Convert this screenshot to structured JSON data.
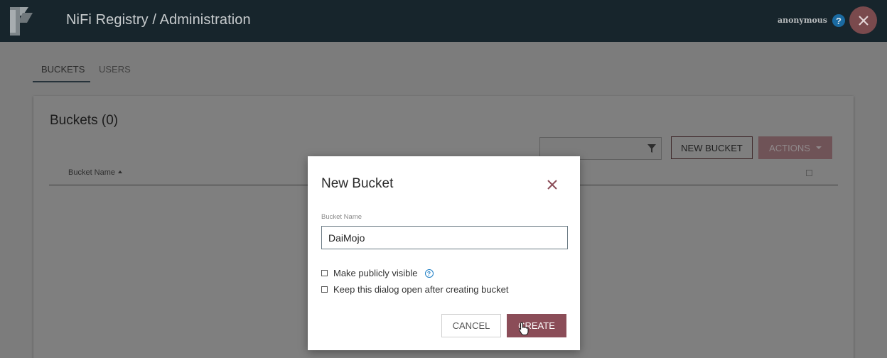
{
  "header": {
    "title": "NiFi Registry / Administration",
    "user": "anonymous",
    "help_glyph": "?",
    "logo_icon": "nifi-registry-logo-icon",
    "close_icon": "close-icon"
  },
  "tabs": [
    {
      "label": "BUCKETS",
      "active": true
    },
    {
      "label": "USERS",
      "active": false
    }
  ],
  "buckets_panel": {
    "title": "Buckets (0)",
    "filter_value": "",
    "filter_icon": "filter-icon",
    "new_bucket_label": "NEW BUCKET",
    "actions_label": "ACTIONS",
    "column_header": "Bucket Name"
  },
  "dialog": {
    "title": "New Bucket",
    "field_label": "Bucket Name",
    "bucket_name_value": "DaiMojo",
    "make_public_label": "Make publicly visible",
    "make_public_checked": false,
    "keep_open_label": "Keep this dialog open after creating bucket",
    "keep_open_checked": false,
    "info_glyph": "?",
    "cancel_label": "CANCEL",
    "create_label": "CREATE"
  },
  "colors": {
    "header_bg": "#17252c",
    "accent": "#8b4d58",
    "overlay": "#7c7c7c",
    "help_blue": "#1a6aa1"
  }
}
